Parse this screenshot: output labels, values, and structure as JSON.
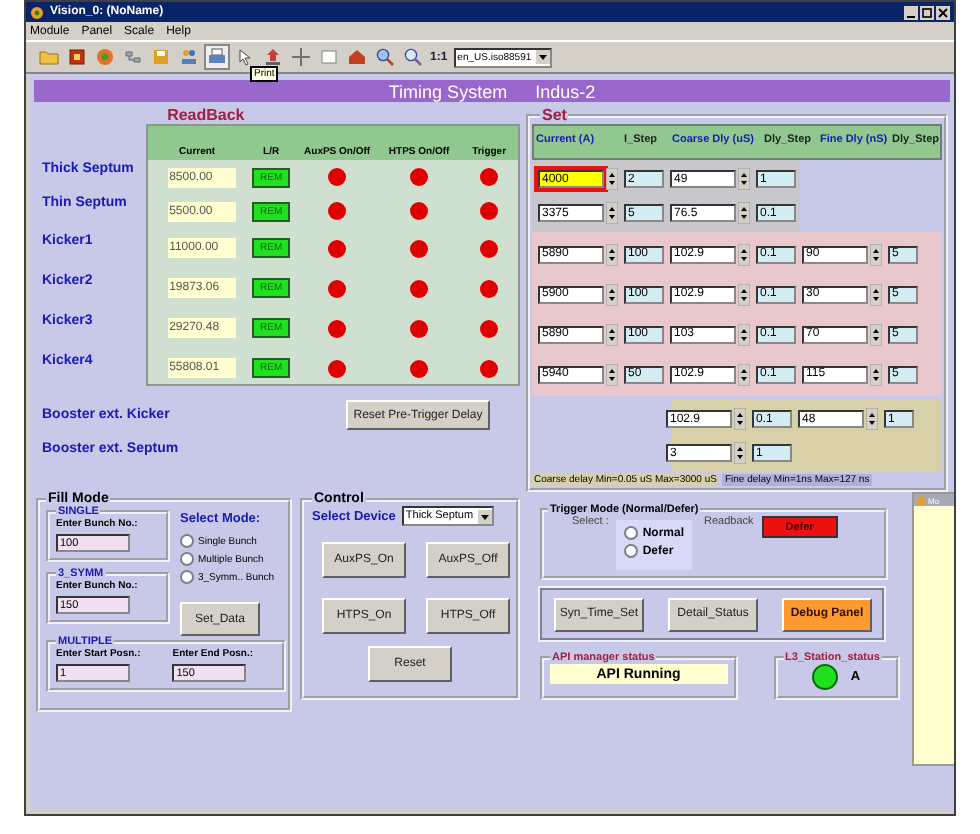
{
  "window": {
    "title": "Vision_0: (NoName)"
  },
  "menu": [
    "Module",
    "Panel",
    "Scale",
    "Help"
  ],
  "toolbar": {
    "zoom_label": "1:1",
    "locale": "en_US.iso88591",
    "tooltip": "Print"
  },
  "banner": {
    "title": "Timing System",
    "subtitle": "Indus-2"
  },
  "readback": {
    "legend": "ReadBack",
    "columns": [
      "Current",
      "L/R",
      "AuxPS On/Off",
      "HTPS On/Off",
      "Trigger"
    ],
    "rows": [
      {
        "device": "Thick Septum",
        "current": "8500.00",
        "mode": "REM",
        "auxps_on": false,
        "htps_on": false,
        "trigger_on": false
      },
      {
        "device": "Thin Septum",
        "current": "5500.00",
        "mode": "REM",
        "auxps_on": false,
        "htps_on": false,
        "trigger_on": false
      },
      {
        "device": "Kicker1",
        "current": "11000.00",
        "mode": "REM",
        "auxps_on": false,
        "htps_on": false,
        "trigger_on": false
      },
      {
        "device": "Kicker2",
        "current": "19873.06",
        "mode": "REM",
        "auxps_on": false,
        "htps_on": false,
        "trigger_on": false
      },
      {
        "device": "Kicker3",
        "current": "29270.48",
        "mode": "REM",
        "auxps_on": false,
        "htps_on": false,
        "trigger_on": false
      },
      {
        "device": "Kicker4",
        "current": "55808.01",
        "mode": "REM",
        "auxps_on": false,
        "htps_on": false,
        "trigger_on": false
      }
    ]
  },
  "booster": [
    "Booster ext. Kicker",
    "Booster ext. Septum"
  ],
  "reset_delay_button": "Reset Pre-Trigger Delay",
  "set": {
    "legend": "Set",
    "columns": [
      "Current (A)",
      "I_Step",
      "Coarse Dly (uS)",
      "Dly_Step",
      "Fine Dly (nS)",
      "Dly_Step"
    ],
    "groups": [
      {
        "color": "#c8c8cc",
        "rows": [
          {
            "current": "4000",
            "i_step": "2",
            "coarse": "49",
            "dly_step": "1",
            "focused": true
          },
          {
            "current": "3375",
            "i_step": "5",
            "coarse": "76.5",
            "dly_step": "0.1",
            "focused": false
          }
        ]
      },
      {
        "color": "#e8c8cc",
        "rows": [
          {
            "current": "5890",
            "i_step": "100",
            "coarse": "102.9",
            "dly_step": "0.1",
            "fine": "90",
            "fine_step": "5",
            "focused": false
          },
          {
            "current": "5900",
            "i_step": "100",
            "coarse": "102.9",
            "dly_step": "0.1",
            "fine": "30",
            "fine_step": "5",
            "focused": false
          },
          {
            "current": "5890",
            "i_step": "100",
            "coarse": "103",
            "dly_step": "0.1",
            "fine": "70",
            "fine_step": "5",
            "focused": false
          },
          {
            "current": "5940",
            "i_step": "50",
            "coarse": "102.9",
            "dly_step": "0.1",
            "fine": "115",
            "fine_step": "5",
            "focused": false
          }
        ]
      },
      {
        "color": "#d8d0a8",
        "rows": [
          {
            "coarse": "102.9",
            "dly_step": "0.1",
            "fine": "48",
            "fine_step": "1",
            "focused": false
          },
          {
            "coarse": "3",
            "dly_step": "1",
            "focused": false
          }
        ]
      }
    ],
    "coarse_note": "Coarse delay Min=0.05 uS Max=3000 uS",
    "fine_note": "Fine delay Min=1ns Max=127 ns"
  },
  "fill_mode": {
    "legend": "Fill Mode",
    "single": {
      "legend": "SINGLE",
      "label": "Enter Bunch No.:",
      "value": "100"
    },
    "symm": {
      "legend": "3_SYMM",
      "label": "Enter Bunch No.:",
      "value": "150"
    },
    "multiple": {
      "legend": "MULTIPLE",
      "start_label": "Enter Start Posn.:",
      "start": "1",
      "end_label": "Enter End Posn.:",
      "end": "150"
    },
    "select_label": "Select Mode:",
    "options": [
      {
        "label": "Single Bunch",
        "selected": false
      },
      {
        "label": "Multiple Bunch",
        "selected": false
      },
      {
        "label": "3_Symm.. Bunch",
        "selected": false
      }
    ],
    "set_button": "Set_Data"
  },
  "control": {
    "legend": "Control",
    "device_label": "Select Device",
    "device": "Thick Septum",
    "buttons": [
      "AuxPS_On",
      "AuxPS_Off",
      "HTPS_On",
      "HTPS_Off",
      "Reset"
    ]
  },
  "trigger": {
    "legend": "Trigger Mode (Normal/Defer)",
    "select_label": "Select :",
    "options": [
      {
        "label": "Normal",
        "selected": false
      },
      {
        "label": "Defer",
        "selected": false
      }
    ],
    "readback_label": "Readback",
    "readback": "Defer"
  },
  "actions": [
    {
      "label": "Syn_Time_Set",
      "kind": "normal"
    },
    {
      "label": "Detail_Status",
      "kind": "normal"
    },
    {
      "label": "Debug Panel",
      "kind": "highlight"
    }
  ],
  "api": {
    "legend": "API manager status",
    "value": "API Running"
  },
  "station": {
    "legend": "L3_Station_status",
    "on": true,
    "label": "A"
  },
  "side_window": {
    "title": "Mo"
  }
}
